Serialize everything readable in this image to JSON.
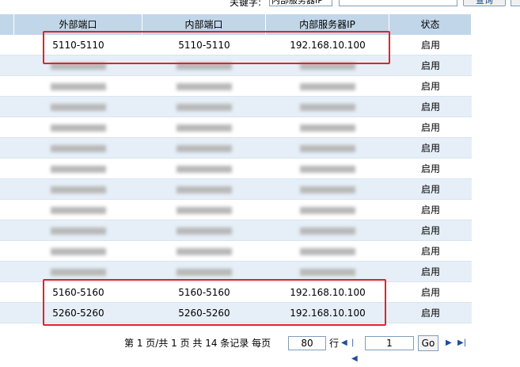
{
  "search": {
    "keyword_label": "关键字:",
    "keyword_select": "内部服务器IP",
    "keyword_value": "",
    "search_button": "查询"
  },
  "table": {
    "headers": [
      "外部端口",
      "内部端口",
      "内部服务器IP",
      "状态"
    ],
    "rows": [
      {
        "ext": "5110-5110",
        "int": "5110-5110",
        "ip": "192.168.10.100",
        "status": "启用",
        "masked": false
      },
      {
        "ext": "",
        "int": "",
        "ip": "",
        "status": "启用",
        "masked": true
      },
      {
        "ext": "",
        "int": "",
        "ip": "",
        "status": "启用",
        "masked": true
      },
      {
        "ext": "",
        "int": "",
        "ip": "",
        "status": "启用",
        "masked": true
      },
      {
        "ext": "",
        "int": "",
        "ip": "",
        "status": "启用",
        "masked": true
      },
      {
        "ext": "",
        "int": "",
        "ip": "",
        "status": "启用",
        "masked": true
      },
      {
        "ext": "",
        "int": "",
        "ip": "",
        "status": "启用",
        "masked": true
      },
      {
        "ext": "",
        "int": "",
        "ip": "",
        "status": "启用",
        "masked": true
      },
      {
        "ext": "",
        "int": "",
        "ip": "",
        "status": "启用",
        "masked": true
      },
      {
        "ext": "",
        "int": "",
        "ip": "",
        "status": "启用",
        "masked": true
      },
      {
        "ext": "",
        "int": "",
        "ip": "",
        "status": "启用",
        "masked": true
      },
      {
        "ext": "",
        "int": "",
        "ip": "",
        "status": "启用",
        "masked": true
      },
      {
        "ext": "5160-5160",
        "int": "5160-5160",
        "ip": "192.168.10.100",
        "status": "启用",
        "masked": false
      },
      {
        "ext": "5260-5260",
        "int": "5260-5260",
        "ip": "192.168.10.100",
        "status": "启用",
        "masked": false
      }
    ]
  },
  "pager": {
    "summary": "第 1 页/共 1 页 共 14 条记录 每页",
    "per_page": "80",
    "per_page_unit": "行",
    "page_input": "1",
    "go_label": "Go",
    "icons": [
      "prev-icon",
      "first-icon",
      "next-icon",
      "last-icon"
    ]
  },
  "colors": {
    "header_bg": "#c2d6ea",
    "row_alt_bg": "#e6eff8",
    "highlight": "#e0242a"
  }
}
